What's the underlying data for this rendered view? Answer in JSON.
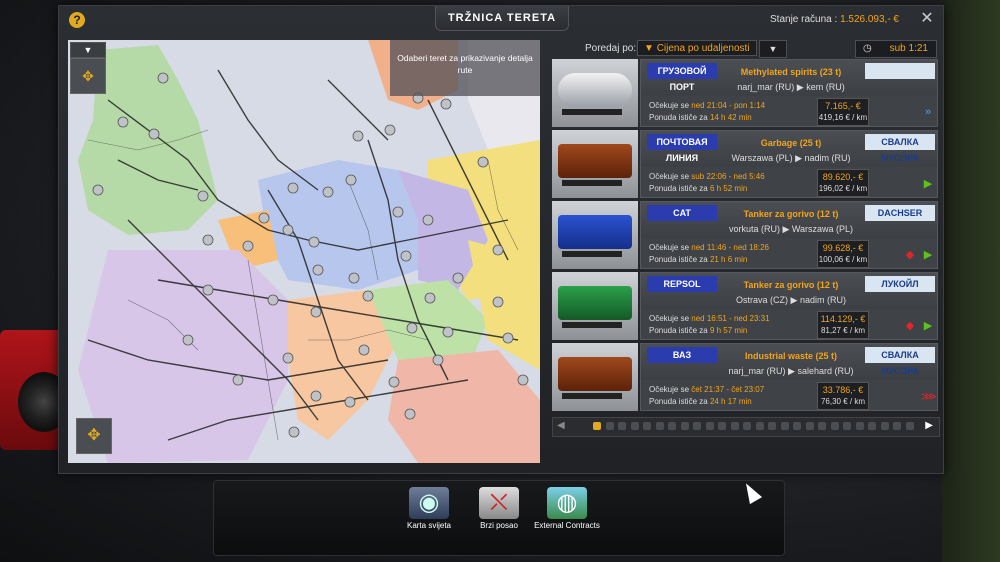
{
  "window": {
    "title": "TRŽNICA TERETA",
    "help_icon": "?",
    "balance_label": "Stanje računa :",
    "balance_value": "1.526.093,- €",
    "close_icon": "✕"
  },
  "map": {
    "collapse_icon": "chevron-down-icon",
    "hint": "Odaberi teret za prikazivanje detalja rute"
  },
  "sort": {
    "label": "Poredaj po:",
    "selected": "Cijena po udaljenosti",
    "selected_icon": "sort-down-icon"
  },
  "clock": {
    "value": "sub 1:21"
  },
  "jobs": [
    {
      "sender_logo": "ГРУЗОВОЙ ПОРТ",
      "receiver_logo": "",
      "cargo": "Methylated spirits (23 t)",
      "route": "narj_mar (RU)  ▶  kem (RU)",
      "expected_label": "Očekuje se",
      "expected": "ned 21:04 - pon 1:14",
      "offer_label": "Ponuda ističe za",
      "offer": "14 h 42 min",
      "pay": "7.165,- €",
      "per_km": "419,16 € / km",
      "action_icons": [
        "double-arrow-icon"
      ],
      "trailer": "tanker"
    },
    {
      "sender_logo": "ПОЧТОВАЯ ЛИНИЯ",
      "receiver_logo": "СВАЛКА МУСОРА",
      "cargo": "Garbage (25 t)",
      "route": "Warszawa (PL)  ▶  nadim (RU)",
      "expected_label": "Očekuje se",
      "expected": "sub 22:06 - ned 5:46",
      "offer_label": "Ponuda ističe za",
      "offer": "6 h 52 min",
      "pay": "89.620,- €",
      "per_km": "196,02 € / km",
      "action_icons": [
        "play-icon"
      ],
      "trailer": "container"
    },
    {
      "sender_logo": "CAT",
      "receiver_logo": "DACHSER",
      "cargo": "Tanker za gorivo (12 t)",
      "route": "vorkuta (RU)  ▶  Warszawa (PL)",
      "expected_label": "Očekuje se",
      "expected": "ned 11:46 - ned 18:26",
      "offer_label": "Ponuda ističe za",
      "offer": "21 h 6 min",
      "pay": "99.628,- €",
      "per_km": "100,06 € / km",
      "action_icons": [
        "hazard-icon",
        "play-icon"
      ],
      "trailer": "tank-blue"
    },
    {
      "sender_logo": "REPSOL",
      "receiver_logo": "ЛУКОЙЛ",
      "cargo": "Tanker za gorivo (12 t)",
      "route": "Ostrava (CZ)  ▶  nadim (RU)",
      "expected_label": "Očekuje se",
      "expected": "ned 16:51 - ned 23:31",
      "offer_label": "Ponuda ističe za",
      "offer": "9 h 57 min",
      "pay": "114.129,- €",
      "per_km": "81,27 € / km",
      "action_icons": [
        "hazard-icon",
        "play-icon"
      ],
      "trailer": "tank-green"
    },
    {
      "sender_logo": "ВАЗ",
      "receiver_logo": "СВАЛКА МУСОРА",
      "cargo": "Industrial waste (25 t)",
      "route": "narj_mar (RU)  ▶  salehard (RU)",
      "expected_label": "Očekuje se",
      "expected": "čet 21:37 - čet 23:07",
      "offer_label": "Ponuda ističe za",
      "offer": "24 h 17 min",
      "pay": "33.786,- €",
      "per_km": "76,30 € / km",
      "action_icons": [
        "triple-arrow-icon"
      ],
      "trailer": "container"
    }
  ],
  "dock": {
    "items": [
      {
        "label": "Karta svijeta",
        "icon": "globe-icon"
      },
      {
        "label": "Brzi posao",
        "icon": "quick-job-icon"
      },
      {
        "label": "External Contracts",
        "icon": "external-contracts-icon"
      }
    ]
  },
  "colors": {
    "accent": "#f2a51a",
    "panel": "#3f4247",
    "green_action": "#5ec21a",
    "red_hazard": "#e0262c",
    "blue_action": "#4aa6e8"
  }
}
